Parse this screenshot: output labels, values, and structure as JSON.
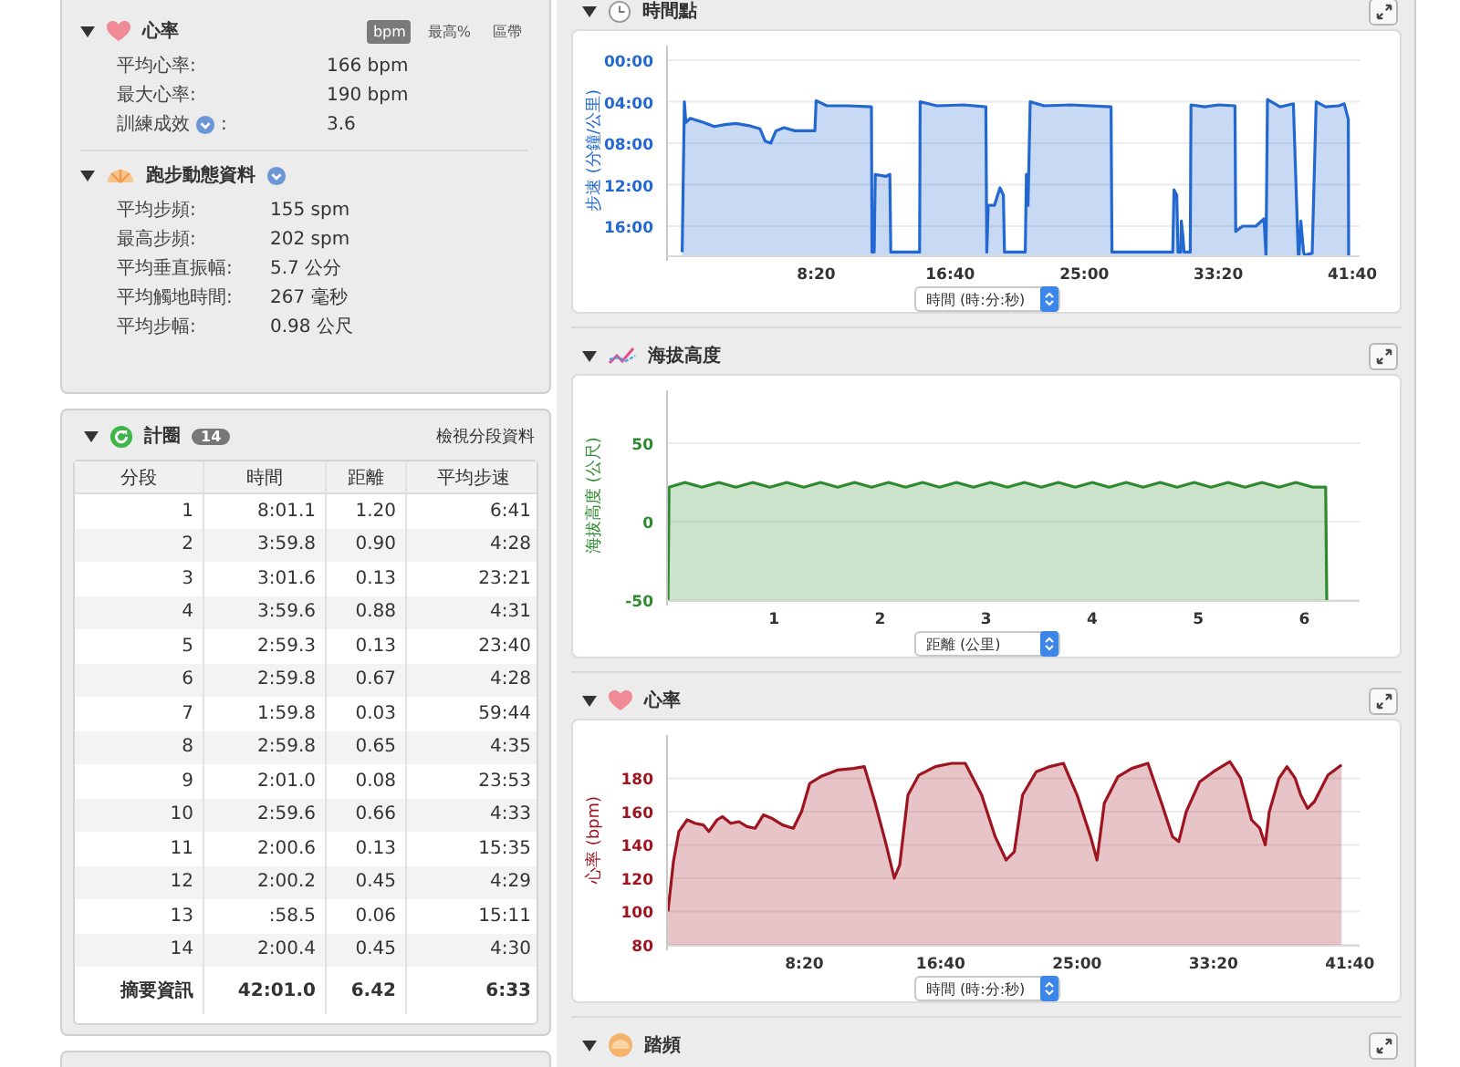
{
  "heart_rate": {
    "title": "心率",
    "expanded": true,
    "units": [
      {
        "label": "bpm",
        "selected": true
      },
      {
        "label": "最高%",
        "selected": false
      },
      {
        "label": "區帶",
        "selected": false
      }
    ],
    "rows": [
      {
        "label": "平均心率:",
        "value": "166 bpm",
        "info": false
      },
      {
        "label": "最大心率:",
        "value": "190 bpm",
        "info": false
      },
      {
        "label": "訓練成效",
        "suffix": ":",
        "value": "3.6",
        "info": true
      }
    ]
  },
  "running_dynamics": {
    "title": "跑步動態資料",
    "expanded": true,
    "info": true,
    "rows": [
      {
        "label": "平均步頻:",
        "value": "155 spm"
      },
      {
        "label": "最高步頻:",
        "value": "202 spm"
      },
      {
        "label": "平均垂直振幅:",
        "value": "5.7 公分"
      },
      {
        "label": "平均觸地時間:",
        "value": "267 毫秒"
      },
      {
        "label": "平均步幅:",
        "value": "0.98 公尺"
      }
    ]
  },
  "laps": {
    "title": "計圈",
    "count": "14",
    "expanded": true,
    "link": "檢視分段資料",
    "columns": [
      "分段",
      "時間",
      "距離",
      "平均步速"
    ],
    "rows": [
      [
        "1",
        "8:01.1",
        "1.20",
        "6:41"
      ],
      [
        "2",
        "3:59.8",
        "0.90",
        "4:28"
      ],
      [
        "3",
        "3:01.6",
        "0.13",
        "23:21"
      ],
      [
        "4",
        "3:59.6",
        "0.88",
        "4:31"
      ],
      [
        "5",
        "2:59.3",
        "0.13",
        "23:40"
      ],
      [
        "6",
        "2:59.8",
        "0.67",
        "4:28"
      ],
      [
        "7",
        "1:59.8",
        "0.03",
        "59:44"
      ],
      [
        "8",
        "2:59.8",
        "0.65",
        "4:35"
      ],
      [
        "9",
        "2:01.0",
        "0.08",
        "23:53"
      ],
      [
        "10",
        "2:59.6",
        "0.66",
        "4:33"
      ],
      [
        "11",
        "2:00.6",
        "0.13",
        "15:35"
      ],
      [
        "12",
        "2:00.2",
        "0.45",
        "4:29"
      ],
      [
        "13",
        ":58.5",
        "0.06",
        "15:11"
      ],
      [
        "14",
        "2:00.4",
        "0.45",
        "4:30"
      ]
    ],
    "summary": [
      "摘要資訊",
      "42:01.0",
      "6.42",
      "6:33"
    ]
  },
  "charts": [
    {
      "kind": "clock",
      "expanded": true,
      "chart_data": {
        "type": "area",
        "title": "時間點",
        "xlabel": "時間 (時:分:秒)",
        "ylabel": "步速 (分鐘/公里)",
        "x": [
          0,
          8,
          14,
          30,
          80,
          120,
          160,
          200,
          250,
          290,
          310,
          330,
          350,
          380,
          420,
          495,
          500,
          540,
          620,
          706,
          708,
          716,
          720,
          760,
          775,
          778,
          886,
          888,
          950,
          1050,
          1133,
          1136,
          1142,
          1165,
          1185,
          1198,
          1202,
          1280,
          1284,
          1290,
          1298,
          1350,
          1450,
          1600,
          1603,
          1830,
          1835,
          1845,
          1850,
          1860,
          1862,
          1868,
          1872,
          1895,
          1898,
          1950,
          2000,
          2062,
          2065,
          2090,
          2140,
          2170,
          2178,
          2183,
          2230,
          2280,
          2298,
          2301,
          2308,
          2318,
          2322,
          2350,
          2365,
          2400,
          2450,
          2470,
          2485,
          2486
        ],
        "series": [
          {
            "color": "#2268d0",
            "values": [
              18.5,
              4,
              6,
              5.6,
              6,
              6.4,
              6.2,
              6.1,
              6.3,
              6.6,
              7.8,
              8,
              6.8,
              6.5,
              6.8,
              6.8,
              3.9,
              4.4,
              4.4,
              4.5,
              18.5,
              18.5,
              11,
              11.2,
              11,
              18.5,
              18.5,
              4,
              4.4,
              4.3,
              4.5,
              18.5,
              14,
              14,
              12.3,
              13,
              18.5,
              18.5,
              11,
              14,
              4,
              4.4,
              4.3,
              4.5,
              18.5,
              18.5,
              12.5,
              13,
              18.5,
              18.5,
              15.5,
              17,
              18.5,
              18.5,
              4.3,
              4.5,
              4.3,
              4.4,
              16.5,
              16,
              16,
              15.3,
              18.8,
              3.8,
              4.5,
              4.2,
              18.8,
              18.8,
              15.5,
              18.5,
              18.8,
              18.6,
              4,
              4.5,
              4.4,
              4.2,
              5.7,
              18.81
            ]
          }
        ],
        "grid": true,
        "xlim": [
          -53,
          2527
        ],
        "ylim": [
          18.81,
          -1.41
        ],
        "xticks": [
          {
            "value": 500,
            "label": "8:20"
          },
          {
            "value": 1000,
            "label": "16:40"
          },
          {
            "value": 1500,
            "label": "25:00"
          },
          {
            "value": 2000,
            "label": "33:20"
          },
          {
            "value": 2500,
            "label": "41:40"
          }
        ],
        "yticks": [
          {
            "value": 0,
            "label": "00:00"
          },
          {
            "value": 4,
            "label": "04:00"
          },
          {
            "value": 8,
            "label": "08:00"
          },
          {
            "value": 12,
            "label": "12:00"
          },
          {
            "value": 16,
            "label": "16:00"
          }
        ]
      }
    },
    {
      "kind": "elevation",
      "expanded": true,
      "chart_data": {
        "type": "area",
        "title": "海拔高度",
        "xlabel": "距離 (公里)",
        "ylabel": "海拔高度 (公尺)",
        "x": [
          0,
          0.01,
          0.16,
          0.32,
          0.48,
          0.64,
          0.8,
          0.96,
          1.12,
          1.28,
          1.44,
          1.6,
          1.76,
          1.92,
          2.08,
          2.24,
          2.4,
          2.56,
          2.72,
          2.88,
          3.04,
          3.2,
          3.36,
          3.52,
          3.68,
          3.84,
          4,
          4.16,
          4.32,
          4.48,
          4.64,
          4.8,
          4.96,
          5.12,
          5.28,
          5.44,
          5.6,
          5.76,
          5.92,
          6.08,
          6.2,
          6.21
        ],
        "grid": true,
        "series": [
          {
            "color": "#2e8a2e",
            "values": [
              -50,
              22,
              25,
              22,
              25,
              22,
              25,
              22,
              25,
              22,
              25,
              22,
              25,
              22,
              25,
              22,
              25,
              22,
              25,
              22,
              25,
              22,
              25,
              22,
              25,
              22,
              25,
              22,
              25,
              22,
              25,
              22,
              25,
              22,
              25,
              22,
              25,
              22,
              25,
              22,
              22,
              -50
            ]
          }
        ],
        "xlim": [
          0,
          6.52
        ],
        "ylim": [
          -50,
          83.7
        ],
        "xticks": [
          1,
          2,
          3,
          4,
          5,
          6
        ],
        "yticks": [
          {
            "value": -50,
            "label": "-50"
          },
          {
            "value": 0,
            "label": "0"
          },
          {
            "value": 50,
            "label": "50"
          }
        ]
      }
    },
    {
      "kind": "heart",
      "expanded": true,
      "chart_data": {
        "type": "area",
        "title": "心率",
        "xlabel": "時間 (時:分:秒)",
        "ylabel": "心率 (bpm)",
        "x": [
          0,
          20,
          40,
          70,
          100,
          130,
          150,
          180,
          200,
          230,
          260,
          290,
          320,
          350,
          380,
          420,
          460,
          490,
          520,
          560,
          620,
          680,
          720,
          760,
          800,
          830,
          850,
          880,
          920,
          980,
          1040,
          1090,
          1150,
          1200,
          1240,
          1270,
          1300,
          1350,
          1400,
          1450,
          1500,
          1550,
          1573,
          1600,
          1650,
          1700,
          1760,
          1810,
          1850,
          1873,
          1900,
          1950,
          2000,
          2060,
          2100,
          2140,
          2170,
          2190,
          2205,
          2240,
          2270,
          2300,
          2320,
          2345,
          2370,
          2420,
          2470
        ],
        "grid": true,
        "series": [
          {
            "color": "#9e1420",
            "values": [
              100,
              130,
              148,
              155,
              153,
              152,
              148,
              155,
              157,
              153,
              154,
              151,
              150,
              158,
              156,
              152,
              150,
              160,
              177,
              181,
              185,
              186,
              187,
              165,
              140,
              120,
              128,
              170,
              182,
              187,
              189,
              189,
              170,
              145,
              131,
              136,
              170,
              184,
              187,
              189,
              170,
              145,
              131,
              165,
              181,
              186,
              189,
              165,
              145,
              142,
              160,
              178,
              184,
              190,
              180,
              155,
              150,
              140,
              160,
              180,
              187,
              180,
              170,
              162,
              166,
              182,
              188
            ]
          }
        ],
        "xlim": [
          0,
          2536
        ],
        "ylim": [
          80,
          206
        ],
        "xticks": [
          {
            "value": 500,
            "label": "8:20"
          },
          {
            "value": 1000,
            "label": "16:40"
          },
          {
            "value": 1500,
            "label": "25:00"
          },
          {
            "value": 2000,
            "label": "33:20"
          },
          {
            "value": 2500,
            "label": "41:40"
          }
        ],
        "yticks": [
          80,
          100,
          120,
          140,
          160,
          180
        ]
      }
    }
  ],
  "next_chart": {
    "kind": "cadence",
    "title": "踏頻",
    "expanded": true
  }
}
